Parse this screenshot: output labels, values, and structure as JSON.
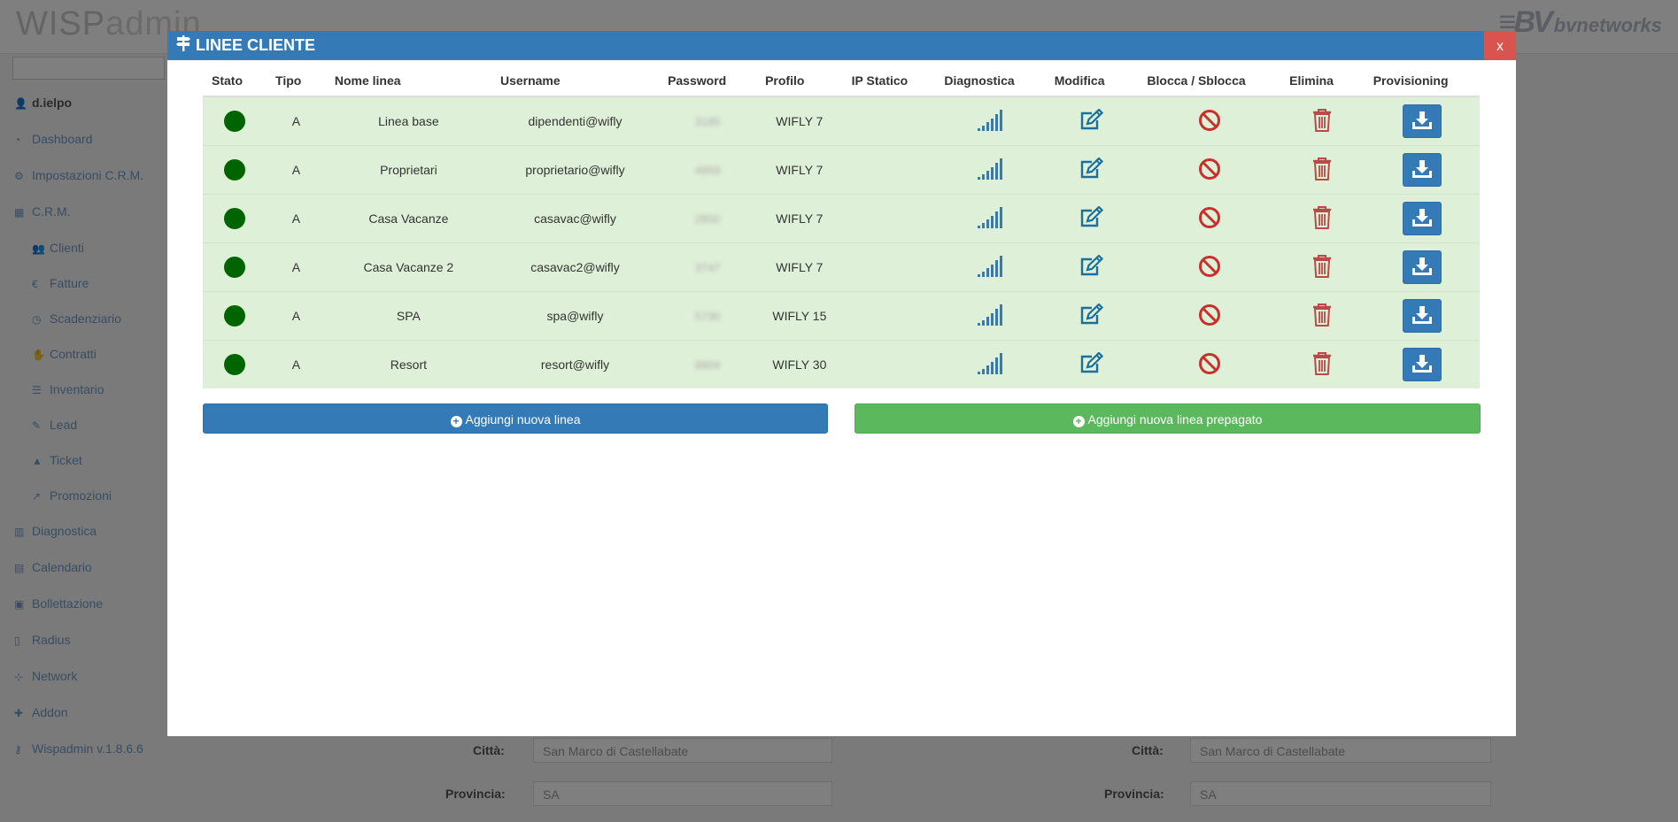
{
  "app": {
    "logo_bold": "WISP",
    "logo_light": "admin",
    "brand": "bvnetworks"
  },
  "sidebar": {
    "user": "d.ielpo",
    "items": [
      {
        "label": "Dashboard",
        "icon": "dashboard-icon",
        "sub": false
      },
      {
        "label": "Impostazioni C.R.M.",
        "icon": "gears-icon",
        "sub": false
      },
      {
        "label": "C.R.M.",
        "icon": "table-icon",
        "sub": false
      },
      {
        "label": "Clienti",
        "icon": "users-icon",
        "sub": true
      },
      {
        "label": "Fatture",
        "icon": "euro-icon",
        "sub": true
      },
      {
        "label": "Scadenziario",
        "icon": "clock-icon",
        "sub": true
      },
      {
        "label": "Contratti",
        "icon": "handshake-icon",
        "sub": true
      },
      {
        "label": "Inventario",
        "icon": "list-icon",
        "sub": true
      },
      {
        "label": "Lead",
        "icon": "edit-icon",
        "sub": true
      },
      {
        "label": "Ticket",
        "icon": "warning-icon",
        "sub": true
      },
      {
        "label": "Promozioni",
        "icon": "chart-icon",
        "sub": true
      },
      {
        "label": "Diagnostica",
        "icon": "bar-chart-icon",
        "sub": false
      },
      {
        "label": "Calendario",
        "icon": "calendar-icon",
        "sub": false
      },
      {
        "label": "Bollettazione",
        "icon": "money-icon",
        "sub": false
      },
      {
        "label": "Radius",
        "icon": "file-icon",
        "sub": false
      },
      {
        "label": "Network",
        "icon": "sitemap-icon",
        "sub": false
      },
      {
        "label": "Addon",
        "icon": "puzzle-icon",
        "sub": false
      },
      {
        "label": "Wispadmin v.1.8.6.6",
        "icon": "key-icon",
        "sub": false
      }
    ]
  },
  "background_form": {
    "citta_label": "Città:",
    "citta_value": "San Marco di Castellabate",
    "provincia_label": "Provincia:",
    "provincia_value": "SA"
  },
  "modal": {
    "title": "LINEE CLIENTE",
    "close_label": "x",
    "columns": [
      "Stato",
      "Tipo",
      "Nome linea",
      "Username",
      "Password",
      "Profilo",
      "IP Statico",
      "Diagnostica",
      "Modifica",
      "Blocca / Sblocca",
      "Elimina",
      "Provisioning"
    ],
    "rows": [
      {
        "tipo": "A",
        "nome": "Linea base",
        "username": "dipendenti@wifly",
        "password": "3185",
        "profilo": "WIFLY 7",
        "ip": ""
      },
      {
        "tipo": "A",
        "nome": "Proprietari",
        "username": "proprietario@wifly",
        "password": "4959",
        "profilo": "WIFLY 7",
        "ip": ""
      },
      {
        "tipo": "A",
        "nome": "Casa Vacanze",
        "username": "casavac@wifly",
        "password": "2850",
        "profilo": "WIFLY 7",
        "ip": ""
      },
      {
        "tipo": "A",
        "nome": "Casa Vacanze 2",
        "username": "casavac2@wifly",
        "password": "3747",
        "profilo": "WIFLY 7",
        "ip": ""
      },
      {
        "tipo": "A",
        "nome": "SPA",
        "username": "spa@wifly",
        "password": "5730",
        "profilo": "WIFLY 15",
        "ip": ""
      },
      {
        "tipo": "A",
        "nome": "Resort",
        "username": "resort@wifly",
        "password": "8804",
        "profilo": "WIFLY 30",
        "ip": ""
      }
    ],
    "add_line_label": "Aggiungi nuova linea",
    "add_prepaid_label": "Aggiungi nuova linea prepagato"
  },
  "colors": {
    "primary": "#337ab7",
    "success": "#5cb85c",
    "danger": "#d9534f",
    "row_bg": "#dff0d8",
    "status_active": "#006400",
    "block_icon": "#c9302c",
    "trash_icon": "#b94a48",
    "edit_icon": "#1a6f9c"
  }
}
